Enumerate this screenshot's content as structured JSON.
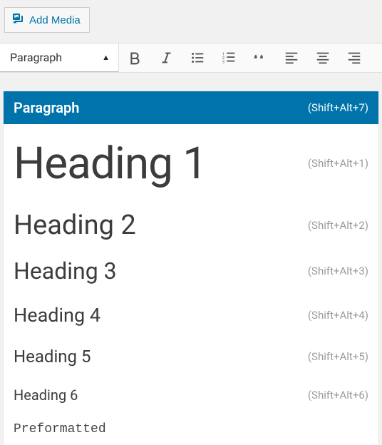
{
  "header": {
    "add_media_label": "Add Media"
  },
  "toolbar": {
    "format_selected": "Paragraph"
  },
  "format_dropdown": {
    "items": [
      {
        "label": "Paragraph",
        "shortcut": "(Shift+Alt+7)",
        "selected": true,
        "class": "selected"
      },
      {
        "label": "Heading 1",
        "shortcut": "(Shift+Alt+1)",
        "selected": false,
        "class": "h1-row"
      },
      {
        "label": "Heading 2",
        "shortcut": "(Shift+Alt+2)",
        "selected": false,
        "class": "h2-row"
      },
      {
        "label": "Heading 3",
        "shortcut": "(Shift+Alt+3)",
        "selected": false,
        "class": "h3-row"
      },
      {
        "label": "Heading 4",
        "shortcut": "(Shift+Alt+4)",
        "selected": false,
        "class": "h4-row"
      },
      {
        "label": "Heading 5",
        "shortcut": "(Shift+Alt+5)",
        "selected": false,
        "class": "h5-row"
      },
      {
        "label": "Heading 6",
        "shortcut": "(Shift+Alt+6)",
        "selected": false,
        "class": "h6-row"
      },
      {
        "label": "Preformatted",
        "shortcut": "",
        "selected": false,
        "class": "pre-row"
      }
    ]
  }
}
